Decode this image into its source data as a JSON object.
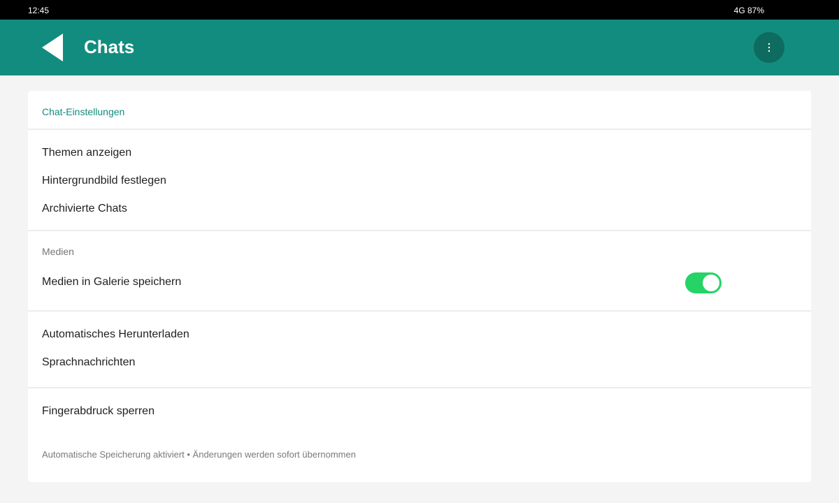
{
  "status_bar": {
    "time": "12:45",
    "network": "4G 87%"
  },
  "header": {
    "title": "Chats",
    "back_icon": "back-arrow-icon",
    "menu_icon": "more-vert-icon"
  },
  "colors": {
    "primary": "#128c7e",
    "primary_dark": "#0e6b60",
    "toggle_on": "#25d366"
  },
  "card": {
    "section_chat": {
      "title": "Chat-Einstellungen",
      "items": [
        "Themen anzeigen",
        "Hintergrundbild festlegen",
        "Archivierte Chats"
      ]
    },
    "section_media": {
      "title": "Medien",
      "toggle_item": {
        "label": "Medien in Galerie speichern",
        "enabled": true
      }
    },
    "section_download": {
      "items": [
        "Automatisches Herunterladen",
        "Sprachnachrichten"
      ]
    },
    "section_lock": {
      "items": [
        "Fingerabdruck sperren"
      ]
    },
    "footnote": "Automatische Speicherung aktiviert • Änderungen werden sofort übernommen"
  }
}
